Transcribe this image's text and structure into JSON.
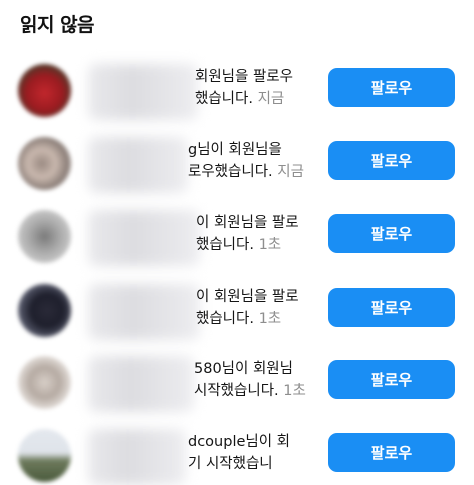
{
  "section": {
    "title": "읽지 않음"
  },
  "follow_label": "팔로우",
  "notifications": [
    {
      "line1": "회원님을 팔로우",
      "line2": "했습니다.",
      "time": "지금"
    },
    {
      "line1": "g님이 회원님을",
      "line2": "로우했습니다.",
      "time": "지금"
    },
    {
      "line1": "이 회원님을 팔로",
      "line2": "했습니다.",
      "time": "1초"
    },
    {
      "line1": "이 회원님을 팔로",
      "line2": "했습니다.",
      "time": "1초"
    },
    {
      "line1": "580님이 회원님",
      "line2": "시작했습니다.",
      "time": "1초"
    },
    {
      "line1": "dcouple님이 회",
      "line2": "기 시작했습니",
      "time": ""
    }
  ],
  "colors": {
    "accent": "#1a8ef4",
    "time_text": "#8e8e8e"
  }
}
